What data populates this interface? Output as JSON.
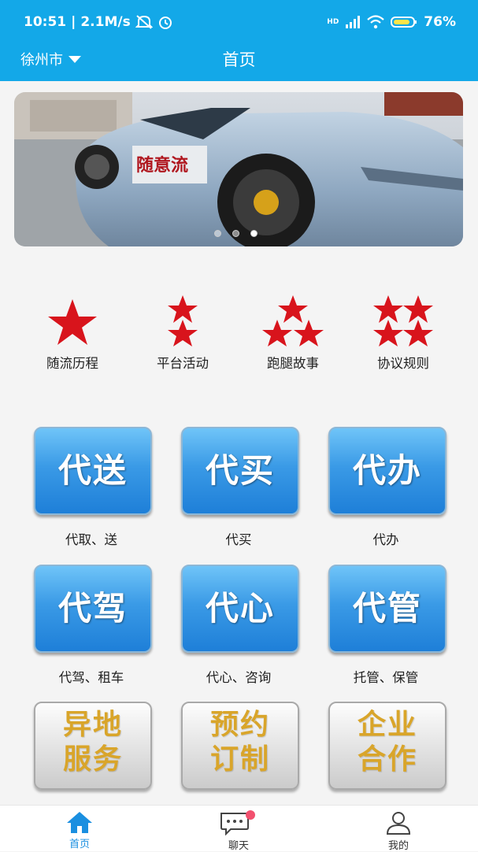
{
  "status_bar": {
    "time": "10:51",
    "speed": "2.1M/s",
    "signal": "HD",
    "battery": "76%"
  },
  "header": {
    "city": "徐州市",
    "title": "首页"
  },
  "banner": {
    "caption": "随意流",
    "slide_count": 3,
    "active_slide": 3
  },
  "categories": [
    {
      "label": "随流历程",
      "icon": "one-star-icon"
    },
    {
      "label": "平台活动",
      "icon": "two-stars-icon"
    },
    {
      "label": "跑腿故事",
      "icon": "three-stars-icon"
    },
    {
      "label": "协议规则",
      "icon": "four-stars-icon"
    }
  ],
  "services": [
    {
      "tile": "代送",
      "label": "代取、送"
    },
    {
      "tile": "代买",
      "label": "代买"
    },
    {
      "tile": "代办",
      "label": "代办"
    },
    {
      "tile": "代驾",
      "label": "代驾、租车"
    },
    {
      "tile": "代心",
      "label": "代心、咨询"
    },
    {
      "tile": "代管",
      "label": "托管、保管"
    }
  ],
  "special_services": [
    {
      "line1": "异地",
      "line2": "服务"
    },
    {
      "line1": "预约",
      "line2": "订制"
    },
    {
      "line1": "企业",
      "line2": "合作"
    }
  ],
  "tabbar": {
    "tabs": [
      {
        "label": "首页",
        "active": true
      },
      {
        "label": "聊天",
        "active": false
      },
      {
        "label": "我的",
        "active": false
      }
    ]
  },
  "colors": {
    "accent": "#13a8e8",
    "star": "#d8141c",
    "gold_text": "#d9a52a",
    "badge": "#f2506e"
  }
}
